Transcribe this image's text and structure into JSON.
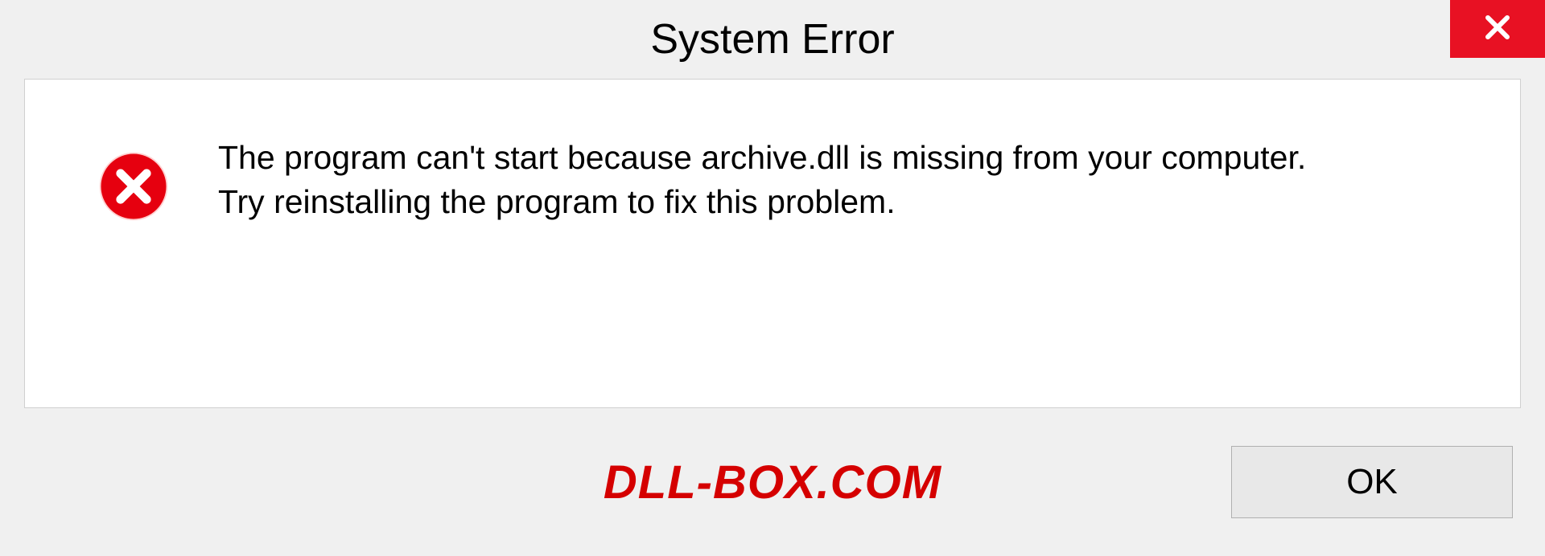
{
  "dialog": {
    "title": "System Error",
    "message_line1": "The program can't start because archive.dll is missing from your computer.",
    "message_line2": "Try reinstalling the program to fix this problem.",
    "ok_label": "OK"
  },
  "watermark": "DLL-BOX.COM",
  "colors": {
    "close_button": "#e81123",
    "error_icon": "#e6000f",
    "watermark": "#d50000"
  }
}
